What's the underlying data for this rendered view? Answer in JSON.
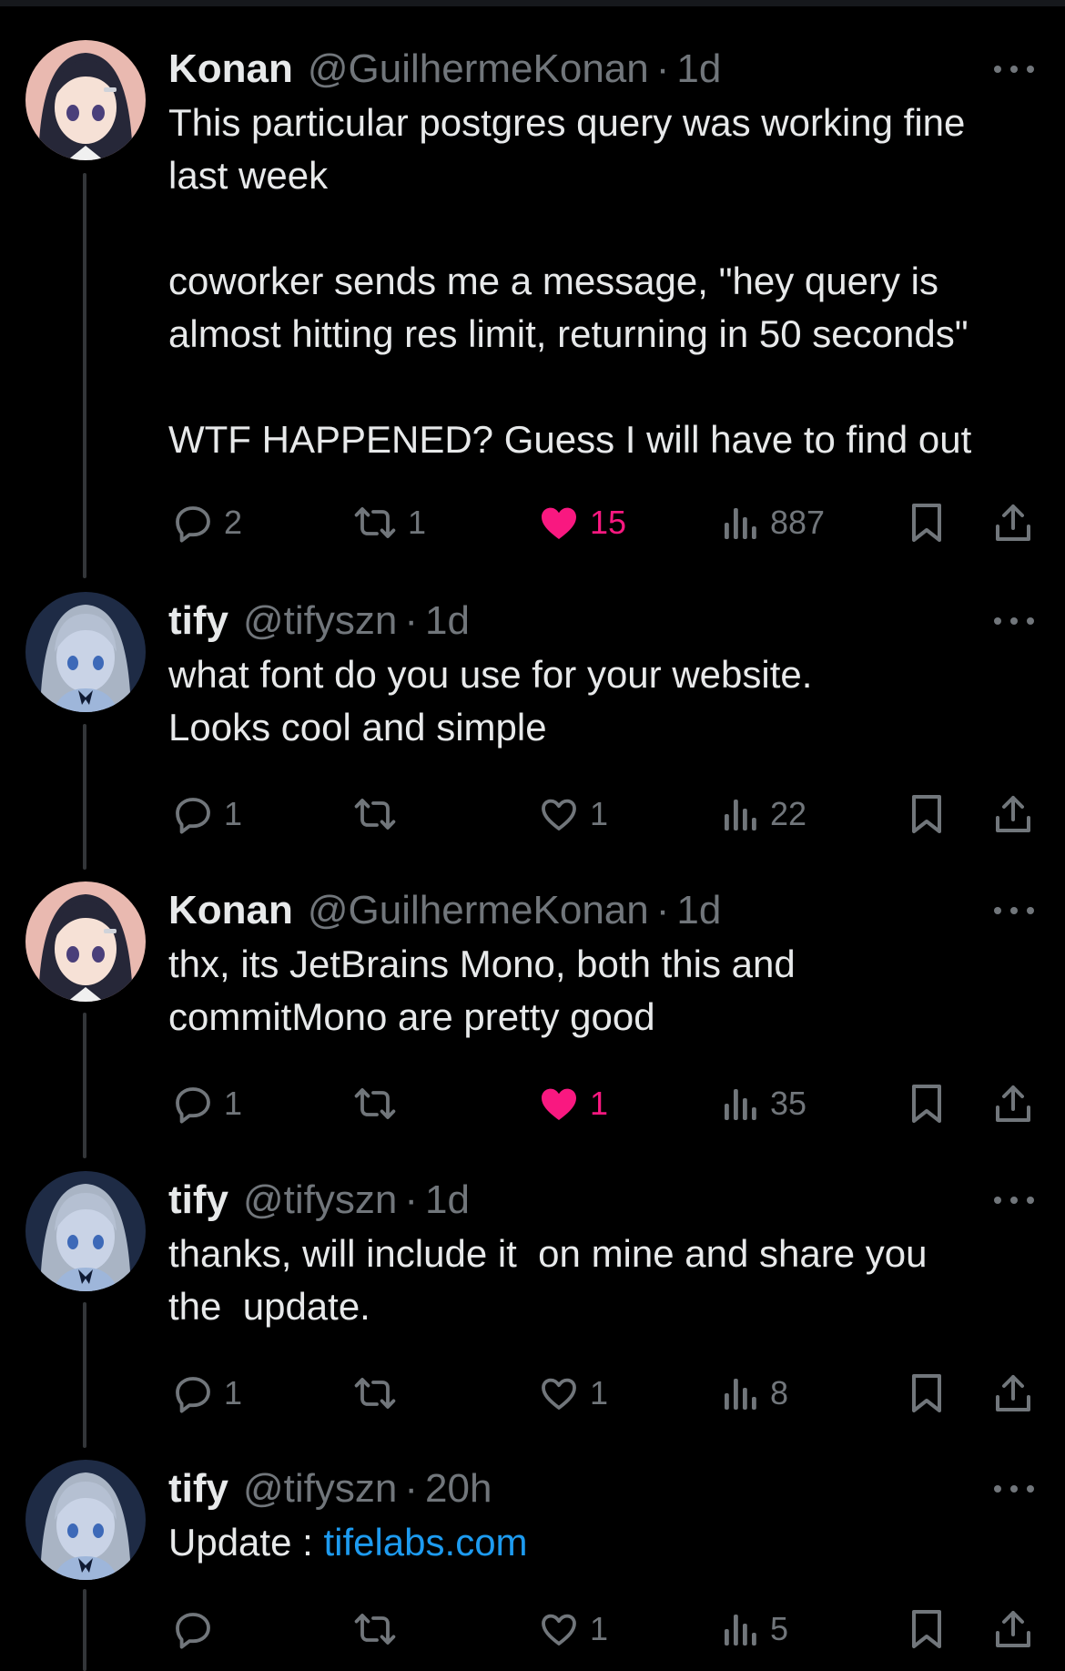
{
  "colors": {
    "background": "#000000",
    "text": "#e7e9ea",
    "muted": "#71767b",
    "like_active": "#f91880",
    "link": "#1d9bf0",
    "thread_line": "#333639"
  },
  "tweets": [
    {
      "name": "Konan",
      "handle": "@GuilhermeKonan",
      "separator": "·",
      "time": "1d",
      "text": "This particular postgres query was working fine\nlast week\n\ncoworker sends me a message, \"hey query is\nalmost hitting res limit, returning in 50 seconds\"\n\nWTF HAPPENED? Guess I will have to find out",
      "replies": "2",
      "reposts": "1",
      "likes": "15",
      "liked": true,
      "views": "887"
    },
    {
      "name": "tify",
      "handle": "@tifyszn",
      "separator": "·",
      "time": "1d",
      "text": "what font do you use for your website.\nLooks cool and simple",
      "replies": "1",
      "reposts": "",
      "likes": "1",
      "liked": false,
      "views": "22"
    },
    {
      "name": "Konan",
      "handle": "@GuilhermeKonan",
      "separator": "·",
      "time": "1d",
      "text": "thx, its JetBrains Mono, both this and\ncommitMono are pretty good",
      "replies": "1",
      "reposts": "",
      "likes": "1",
      "liked": true,
      "views": "35"
    },
    {
      "name": "tify",
      "handle": "@tifyszn",
      "separator": "·",
      "time": "1d",
      "text": "thanks, will include it  on mine and share you\nthe  update.",
      "replies": "1",
      "reposts": "",
      "likes": "1",
      "liked": false,
      "views": "8"
    },
    {
      "name": "tify",
      "handle": "@tifyszn",
      "separator": "·",
      "time": "20h",
      "text_prefix": "Update : ",
      "link_text": "tifelabs.com",
      "replies": "",
      "reposts": "",
      "likes": "1",
      "liked": false,
      "views": "5"
    }
  ]
}
